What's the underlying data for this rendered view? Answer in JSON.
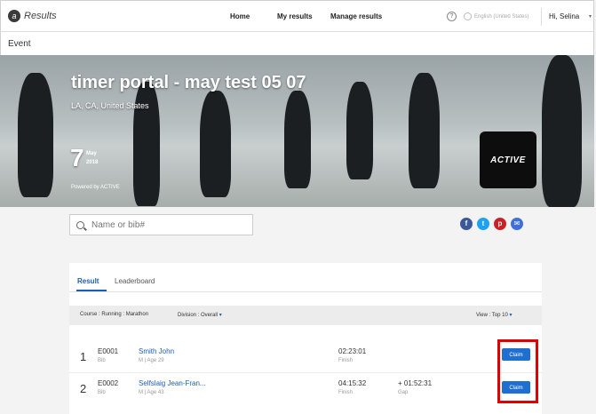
{
  "nav": {
    "logo_text": "Results",
    "logo_mark": "a",
    "links": [
      "Home",
      "My results",
      "Manage results"
    ],
    "help_icon": "question-circle-icon",
    "language": "English (United States)",
    "user": "Hi, Selina",
    "user_caret": "▾"
  },
  "event_label": "Event",
  "hero": {
    "title": "timer portal - may test 05 07",
    "location": "LA, CA, United States",
    "day": "7",
    "month": "May",
    "year": "2018",
    "powered": "Powered by ACTIVE",
    "badge": "ACTIVE"
  },
  "search": {
    "placeholder": "Name or bib#"
  },
  "social": [
    {
      "name": "facebook-icon",
      "glyph": "f",
      "color": "#3b5998"
    },
    {
      "name": "twitter-icon",
      "glyph": "t",
      "color": "#1da1f2"
    },
    {
      "name": "pinterest-icon",
      "glyph": "p",
      "color": "#cb2027"
    },
    {
      "name": "email-icon",
      "glyph": "✉",
      "color": "#3f6fd8"
    }
  ],
  "tabs": {
    "result": "Result",
    "leaderboard": "Leaderboard"
  },
  "filters": {
    "course_label": "Course :",
    "course_value": "Running : Marathon",
    "division_label": "Division :",
    "division_value": "Overall",
    "view_label": "View :",
    "view_value": "Top 10",
    "caret": "▾"
  },
  "results": [
    {
      "rank": "1",
      "bib": "E0001",
      "bib_label": "Bib",
      "name": "Smith John",
      "info": "M | Age 29",
      "time": "02:23:01",
      "time_label": "Finish",
      "gap": "",
      "gap_label": "",
      "claim": "Claim"
    },
    {
      "rank": "2",
      "bib": "E0002",
      "bib_label": "Bib",
      "name": "Selfslaig Jean-Fran...",
      "info": "M | Age 43",
      "time": "04:15:32",
      "time_label": "Finish",
      "gap": "+ 01:52:31",
      "gap_label": "Gap",
      "claim": "Claim"
    }
  ],
  "colors": {
    "accent": "#1d5fb3",
    "claim_button": "#1f6fd1",
    "highlight": "#e00000"
  }
}
